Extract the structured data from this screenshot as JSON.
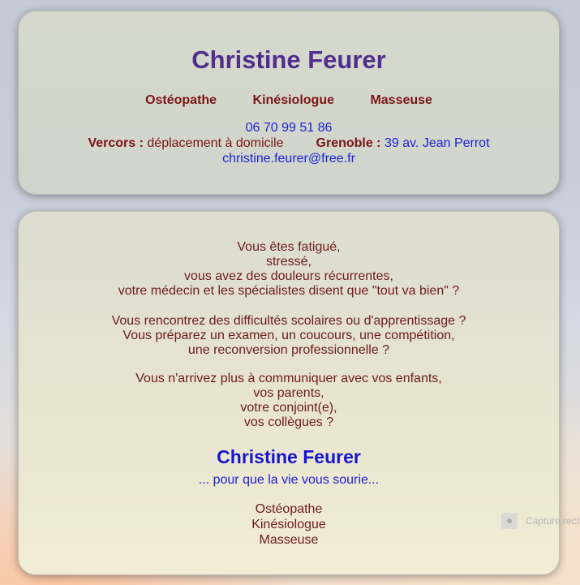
{
  "header": {
    "name": "Christine Feurer",
    "professions": [
      "Ostéopathe",
      "Kinésiologue",
      "Masseuse"
    ],
    "phone": "06 70 99 51 86",
    "vercors_label": "Vercors :",
    "vercors_text": "déplacement à domicile",
    "grenoble_label": "Grenoble :",
    "grenoble_address": "39 av. Jean Perrot",
    "email": "christine.feurer@free.fr"
  },
  "main": {
    "paragraph1": [
      "Vous êtes fatigué,",
      "stressé,",
      "vous avez des douleurs récurrentes,",
      "votre médecin et les spécialistes disent que \"tout va bien\" ?"
    ],
    "paragraph2": [
      "Vous rencontrez des difficultés scolaires ou d'apprentissage ?",
      "Vous préparez un examen, un coucours, une compétition,",
      "une reconversion professionnelle ?"
    ],
    "paragraph3": [
      "Vous n'arrivez plus à communiquer avec vos enfants,",
      "vos parents,",
      "votre conjoint(e),",
      "vos collègues ?"
    ],
    "name": "Christine Feurer",
    "tagline": "... pour que la vie vous sourie...",
    "professions": [
      "Ostéopathe",
      "Kinésiologue",
      "Masseuse"
    ]
  },
  "overlay": {
    "capture_text": "Capture rect"
  }
}
